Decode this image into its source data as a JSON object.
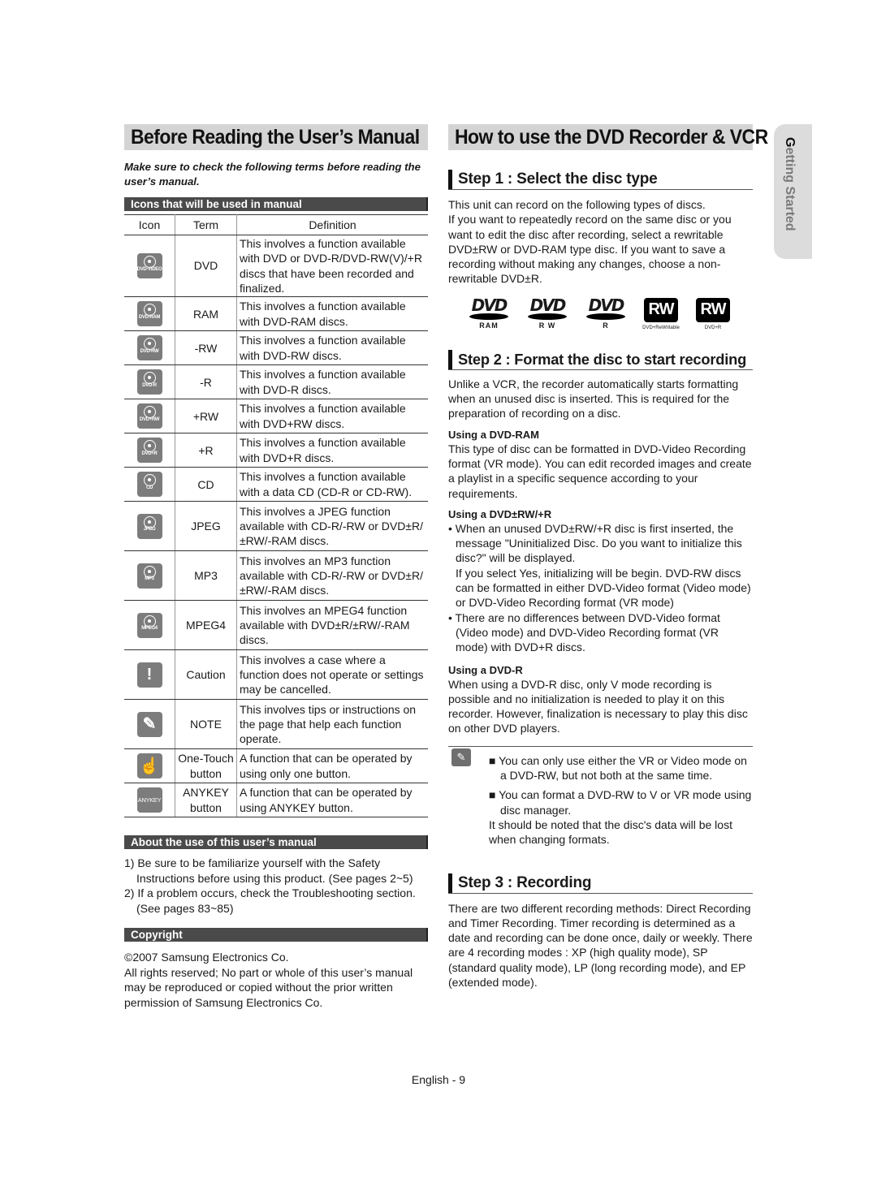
{
  "left": {
    "title": "Before Reading the User’s Manual",
    "intro": "Make sure to check the following terms before reading the user’s manual.",
    "icons_section": {
      "heading": "Icons that will be used in manual",
      "columns": [
        "Icon",
        "Term",
        "Definition"
      ],
      "rows": [
        {
          "icon": "dvd-video-icon",
          "icon_label": "DVD-VIDEO",
          "term": "DVD",
          "definition": "This involves a function available with DVD or DVD-R/DVD-RW(V)/+R discs that have been recorded and finalized."
        },
        {
          "icon": "dvd-ram-icon",
          "icon_label": "DVD-RAM",
          "term": "RAM",
          "definition": "This involves a function available with DVD-RAM discs."
        },
        {
          "icon": "dvd-rw-icon",
          "icon_label": "DVD-RW",
          "term": "-RW",
          "definition": "This involves a function available with DVD-RW discs."
        },
        {
          "icon": "dvd-r-icon",
          "icon_label": "DVD-R",
          "term": "-R",
          "definition": "This involves a function available with DVD-R discs."
        },
        {
          "icon": "dvd-plus-rw-icon",
          "icon_label": "DVD+RW",
          "term": "+RW",
          "definition": "This involves a function available with DVD+RW discs."
        },
        {
          "icon": "dvd-plus-r-icon",
          "icon_label": "DVD+R",
          "term": "+R",
          "definition": "This involves a function available with DVD+R discs."
        },
        {
          "icon": "cd-icon",
          "icon_label": "CD",
          "term": "CD",
          "definition": "This involves a function available with a data CD (CD-R or CD-RW)."
        },
        {
          "icon": "jpeg-icon",
          "icon_label": "JPEG",
          "term": "JPEG",
          "definition": "This involves a JPEG function available with CD-R/-RW or DVD±R/±RW/-RAM discs."
        },
        {
          "icon": "mp3-icon",
          "icon_label": "MP3",
          "term": "MP3",
          "definition": "This involves an MP3 function available with CD-R/-RW or DVD±R/±RW/-RAM discs."
        },
        {
          "icon": "mpeg4-icon",
          "icon_label": "MPEG4",
          "term": "MPEG4",
          "definition": "This involves an MPEG4 function available with DVD±R/±RW/-RAM discs."
        },
        {
          "icon": "caution-icon",
          "icon_label": "!",
          "term": "Caution",
          "definition": "This involves a case where a function does not operate or settings may be cancelled."
        },
        {
          "icon": "note-pencil-icon",
          "icon_label": "✎",
          "term": "NOTE",
          "definition": "This involves tips or instructions on the page that help each function operate."
        },
        {
          "icon": "one-touch-hand-icon",
          "icon_label": "☝",
          "term": "One-Touch button",
          "definition": "A function that can be operated by using only one button."
        },
        {
          "icon": "anykey-icon",
          "icon_label": "ANYKEY",
          "term": "ANYKEY button",
          "definition": "A function that can be operated by using ANYKEY button."
        }
      ]
    },
    "about_section": {
      "heading": "About the use of this user’s manual",
      "items": [
        "1) Be sure to be familiarize yourself with the Safety Instructions before using this product. (See pages 2~5)",
        "2) If a problem occurs, check the Troubleshooting section. (See pages 83~85)"
      ]
    },
    "copyright_section": {
      "heading": "Copyright",
      "line1": "©2007 Samsung Electronics Co.",
      "line2": "All rights reserved; No part or whole of this user’s manual may be reproduced or copied without the prior written permission of Samsung Electronics Co."
    }
  },
  "right": {
    "title": "How to use the DVD Recorder & VCR",
    "step1": {
      "heading": "Step 1 : Select the disc type",
      "text1": "This unit can record on the following types of discs.",
      "text2": "If you want to repeatedly record on the same disc or you want to edit the disc after recording, select a rewritable DVD±RW or DVD-RAM type disc. If you want to save a recording without making any changes, choose a non-rewritable DVD±R.",
      "logos": [
        {
          "mark": "DVD",
          "caption": "RAM"
        },
        {
          "mark": "DVD",
          "caption": "R W"
        },
        {
          "mark": "DVD",
          "caption": "R"
        },
        {
          "mark": "RW",
          "caption": "DVD+ReWritable"
        },
        {
          "mark": "RW",
          "caption": "DVD+R"
        }
      ]
    },
    "step2": {
      "heading": "Step 2 : Format the disc to start recording",
      "text": "Unlike a VCR, the recorder automatically starts formatting when an unused disc is inserted. This is required for the preparation of recording on a disc.",
      "ram_heading": "Using a DVD-RAM",
      "ram_text": "This type of disc can be formatted in DVD-Video Recording format (VR mode). You can edit recorded images and create a playlist in a specific sequence according to your requirements.",
      "rw_heading": "Using a DVD±RW/+R",
      "rw_bullet1": "• When an unused DVD±RW/+R disc is first inserted, the message \"Uninitialized Disc. Do you want to initialize this disc?\" will be displayed.",
      "rw_bullet1b": "If you select Yes, initializing will be begin. DVD-RW discs can be formatted in either DVD-Video format (Video mode) or DVD-Video Recording format (VR mode)",
      "rw_bullet2": "• There are no differences between DVD-Video format (Video mode) and DVD-Video Recording format (VR mode) with DVD+R discs.",
      "r_heading": "Using a DVD-R",
      "r_text": "When using a DVD-R disc, only V mode recording is possible and no initialization is needed to play it on this recorder. However, finalization is necessary to play this disc on other DVD players.",
      "notes": [
        "■ You can only use either the VR or Video mode on a DVD-RW, but not both at the same time.",
        "■ You can format a DVD-RW to V or VR mode using disc manager."
      ],
      "note2_extra": "It should be noted that the disc's data will be lost when changing formats."
    },
    "step3": {
      "heading": "Step 3 : Recording",
      "text": "There are two different recording methods: Direct Recording and Timer Recording. Timer recording is determined as a date and recording can be done once, daily or weekly. There are 4 recording modes : XP (high quality mode), SP (standard quality mode), LP (long recording mode), and EP (extended mode)."
    }
  },
  "side_tab": {
    "first": "G",
    "rest": "etting Started"
  },
  "footer": "English - 9"
}
